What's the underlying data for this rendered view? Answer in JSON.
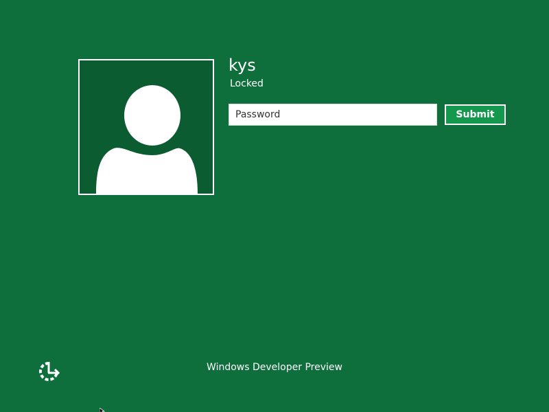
{
  "user": {
    "name": "kys",
    "status": "Locked",
    "avatar_icon": "default-user-silhouette-icon"
  },
  "login": {
    "password_placeholder": "Password",
    "password_value": "",
    "submit_label": "Submit"
  },
  "footer": {
    "text": "Windows Developer Preview",
    "ease_of_access_icon": "ease-of-access-icon"
  },
  "colors": {
    "background": "#0e6e3c",
    "avatar_background": "#0b5c30",
    "submit_background": "#14984e",
    "foreground": "#ffffff"
  }
}
